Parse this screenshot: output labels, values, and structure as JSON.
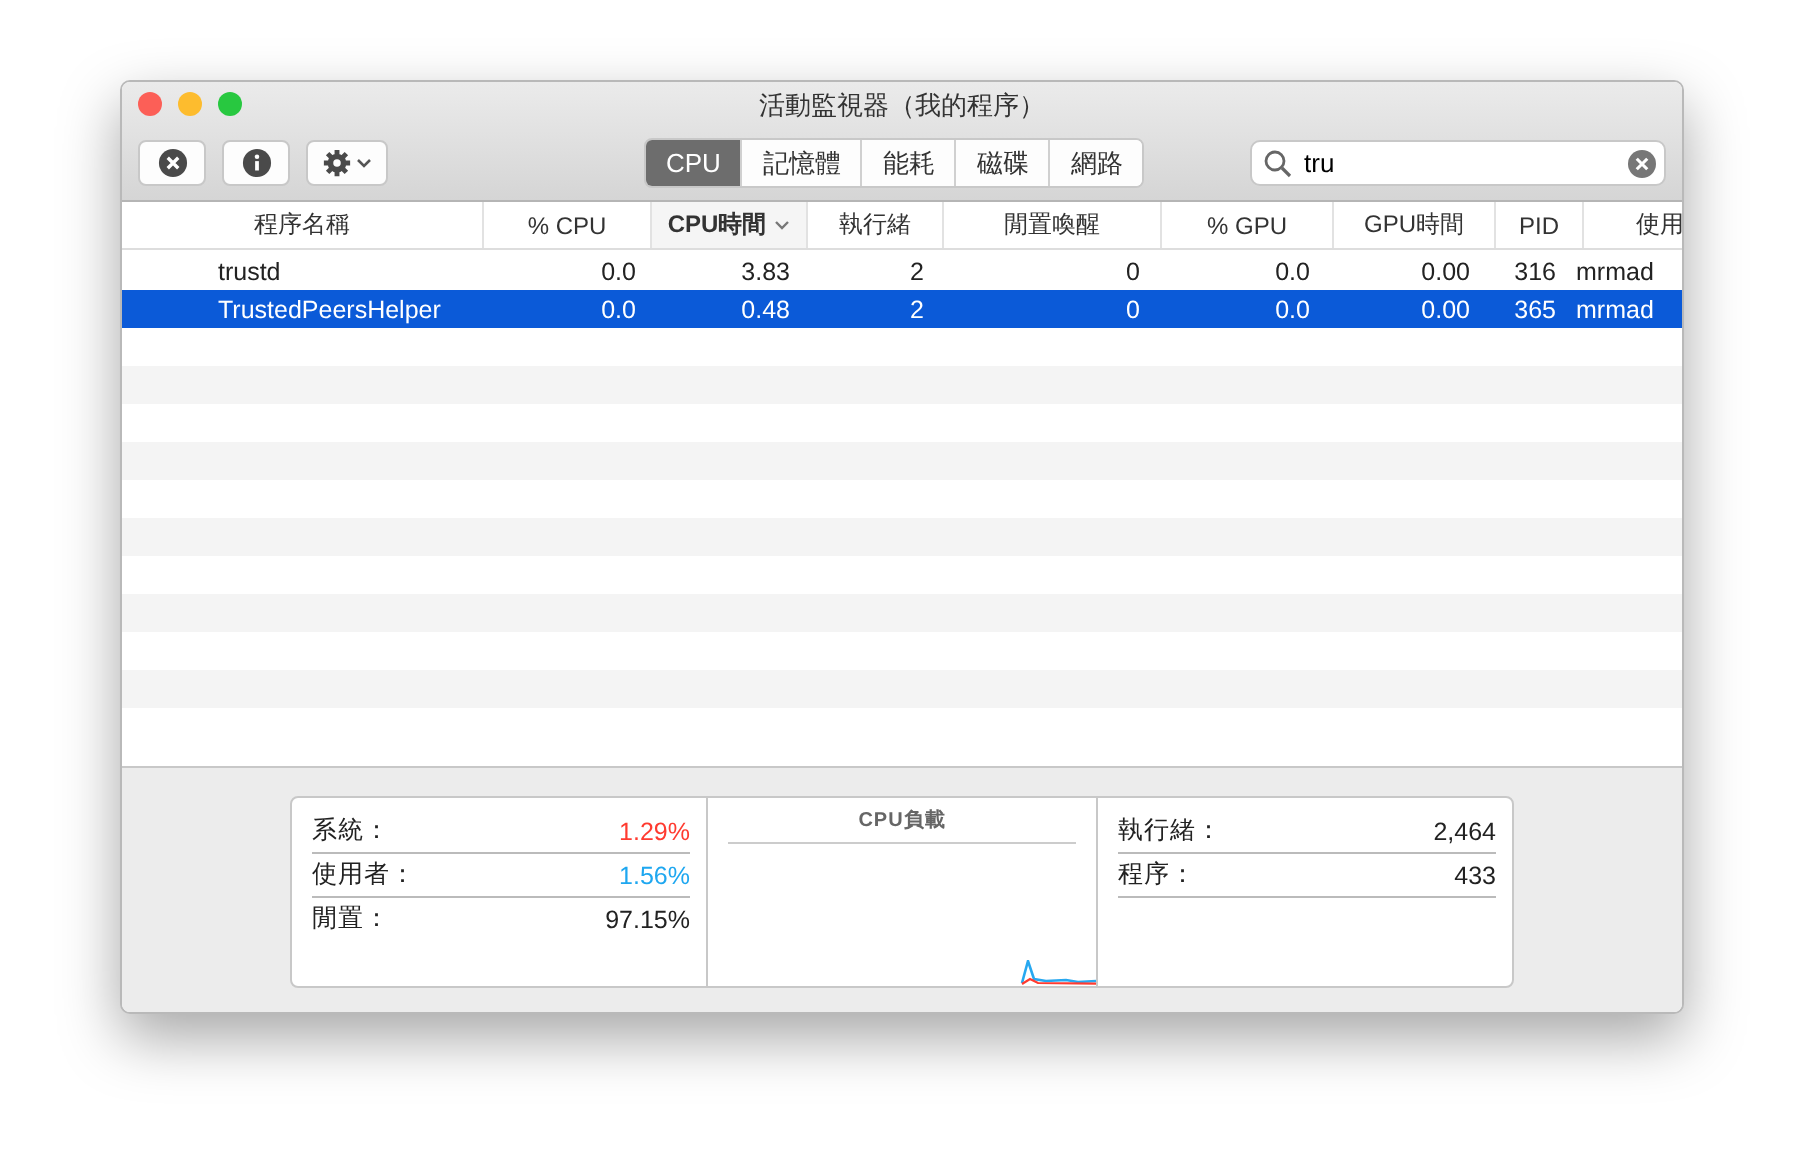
{
  "window": {
    "title": "活動監視器（我的程序）"
  },
  "toolbar": {
    "buttons": [
      {
        "kind": "stop"
      },
      {
        "kind": "info"
      },
      {
        "kind": "gear"
      }
    ],
    "tabs": [
      {
        "label": "CPU",
        "selected": true
      },
      {
        "label": "記憶體",
        "selected": false
      },
      {
        "label": "能耗",
        "selected": false
      },
      {
        "label": "磁碟",
        "selected": false
      },
      {
        "label": "網路",
        "selected": false
      }
    ],
    "search": {
      "value": "tru"
    }
  },
  "table": {
    "columns": [
      {
        "label": "程序名稱",
        "sorted": false
      },
      {
        "label": "% CPU",
        "sorted": false
      },
      {
        "label": "CPU時間",
        "sorted": true
      },
      {
        "label": "執行緒",
        "sorted": false
      },
      {
        "label": "閒置喚醒",
        "sorted": false
      },
      {
        "label": "% GPU",
        "sorted": false
      },
      {
        "label": "GPU時間",
        "sorted": false
      },
      {
        "label": "PID",
        "sorted": false
      },
      {
        "label": "使用",
        "sorted": false
      }
    ],
    "rows": [
      {
        "cells": [
          "trustd",
          "0.0",
          "3.83",
          "2",
          "0",
          "0.0",
          "0.00",
          "316",
          "mrmad"
        ],
        "selected": false
      },
      {
        "cells": [
          "TrustedPeersHelper",
          "0.0",
          "0.48",
          "2",
          "0",
          "0.0",
          "0.00",
          "365",
          "mrmad"
        ],
        "selected": true
      }
    ]
  },
  "summary": {
    "left": [
      {
        "label": "系統：",
        "value": "1.29%",
        "color": "#ff3b30"
      },
      {
        "label": "使用者：",
        "value": "1.56%",
        "color": "#1ea7f0"
      },
      {
        "label": "閒置：",
        "value": "97.15%",
        "color": "#222222"
      }
    ],
    "chart_title": "CPU負載",
    "right": [
      {
        "label": "執行緒：",
        "value": "2,464"
      },
      {
        "label": "程序：",
        "value": "433"
      }
    ]
  }
}
